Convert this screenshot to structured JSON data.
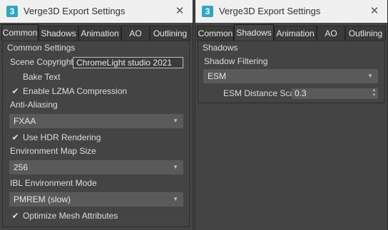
{
  "window1": {
    "title": "Verge3D Export Settings",
    "icon_letter": "3",
    "close_glyph": "✕",
    "tabs": [
      "Common",
      "Shadows",
      "Animation",
      "AO",
      "Outlining"
    ],
    "active_tab": "Common",
    "section_title": "Common Settings",
    "scene_copyright_label": "Scene Copyright:",
    "scene_copyright_value": "ChromeLight studio 2021",
    "bake_text": {
      "label": "Bake Text",
      "checked": false
    },
    "lzma": {
      "label": "Enable LZMA Compression",
      "checked": true
    },
    "anti_aliasing": {
      "label": "Anti-Aliasing",
      "value": "FXAA"
    },
    "hdr": {
      "label": "Use HDR Rendering",
      "checked": true
    },
    "env_map_size": {
      "label": "Environment Map Size",
      "value": "256"
    },
    "ibl_mode": {
      "label": "IBL Environment Mode",
      "value": "PMREM (slow)"
    },
    "optimize_mesh": {
      "label": "Optimize Mesh Attributes",
      "checked": true
    }
  },
  "window2": {
    "title": "Verge3D Export Settings",
    "icon_letter": "3",
    "close_glyph": "✕",
    "tabs": [
      "Common",
      "Shadows",
      "Animation",
      "AO",
      "Outlining"
    ],
    "active_tab": "Shadows",
    "section_title": "Shadows",
    "shadow_filtering": {
      "label": "Shadow Filtering",
      "value": "ESM"
    },
    "esm_distance_scale": {
      "label": "ESM Distance Scale",
      "value": "0.3"
    }
  },
  "glyphs": {
    "check": "✔",
    "dropdown_arrow": "▼",
    "spin_up": "▲",
    "spin_down": "▼"
  }
}
